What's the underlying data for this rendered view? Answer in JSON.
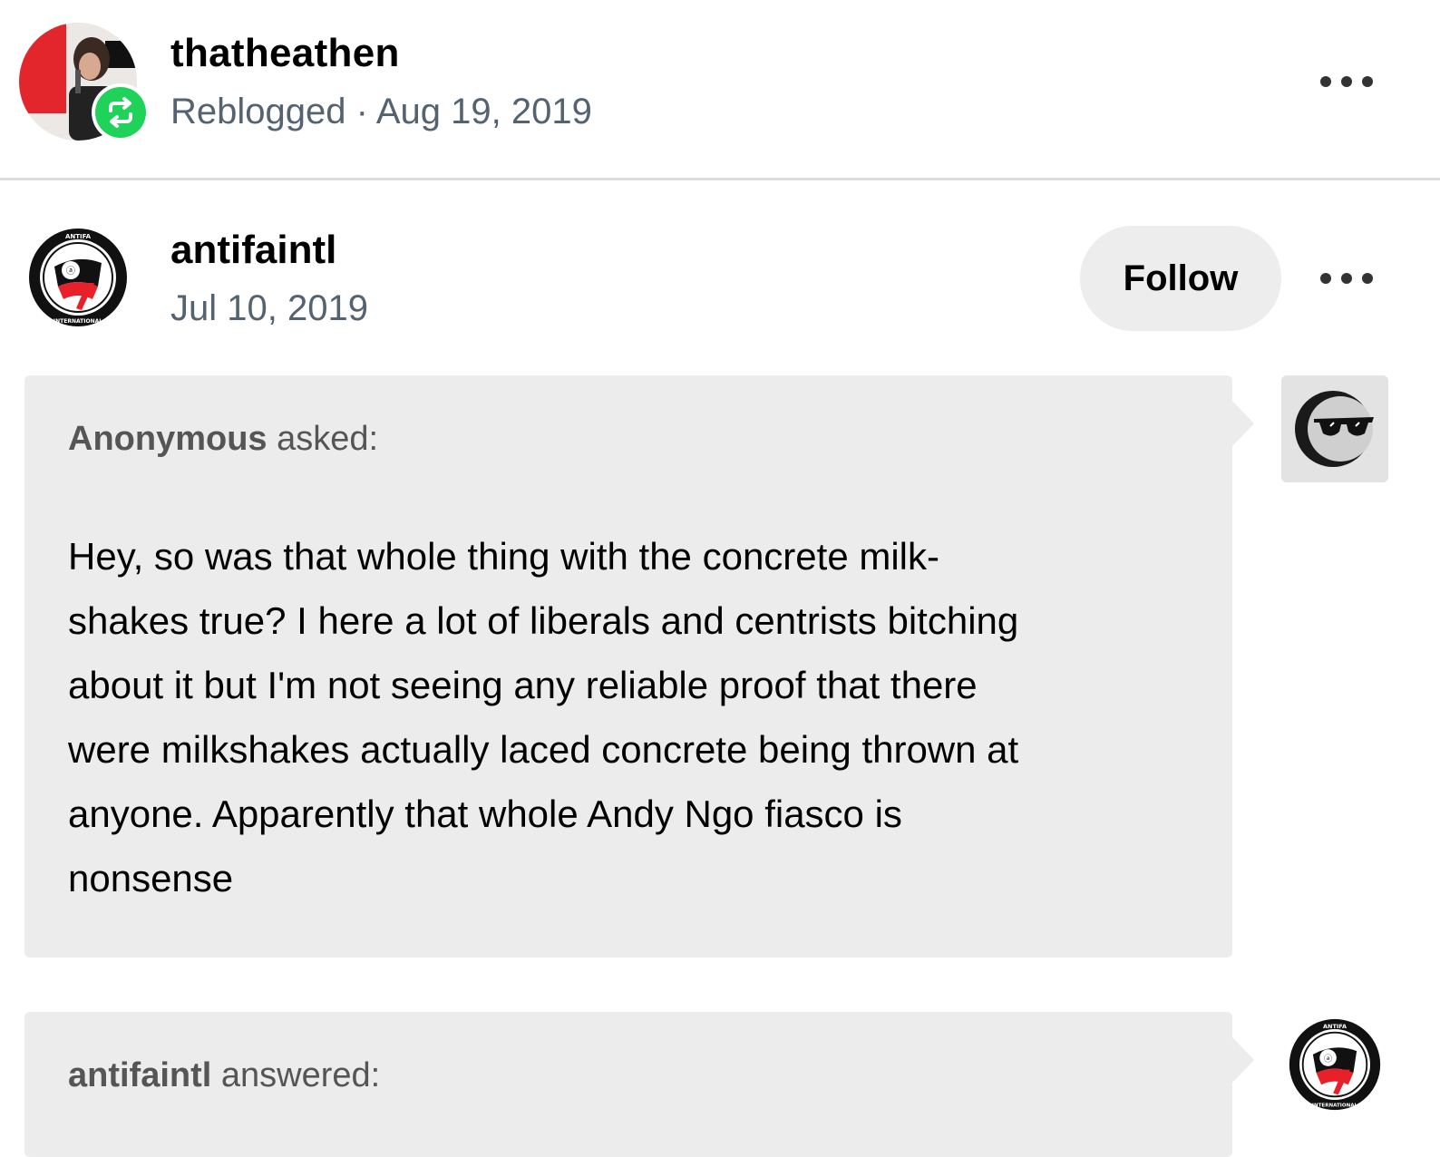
{
  "reblog_header": {
    "username": "thatheathen",
    "status": "Reblogged",
    "separator": "·",
    "date": "Aug 19, 2019",
    "avatar_icon": "reblogger-avatar",
    "badge_icon": "reblog-icon",
    "badge_color": "#1fd35a",
    "menu_icon": "more-options-icon"
  },
  "post": {
    "author": "antifaintl",
    "date": "Jul 10, 2019",
    "follow_label": "Follow",
    "avatar_icon": "antifa-international-logo",
    "logo_text_top": "ANTIFA",
    "logo_text_bottom": "INTERNATIONAL",
    "menu_icon": "more-options-icon"
  },
  "ask": {
    "asker": "Anonymous",
    "asked_suffix": " asked:",
    "question": "Hey, so was that whole thing with the concrete milk-shakes true? I here a lot of liberals and centrists bitching about it but I'm not seeing any reliable proof that there were milkshakes actually laced concrete being thrown at anyone. Apparently that whole Andy Ngo fiasco is nonsense",
    "question_lines": [
      "Hey, so was that whole thing with the concrete milk-",
      "shakes true? I here a lot of liberals and centrists bitching",
      "about it but I'm not seeing any reliable proof that there",
      "were milkshakes actually laced concrete being thrown at",
      "anyone. Apparently that whole Andy Ngo fiasco is",
      "nonsense"
    ],
    "asker_avatar_icon": "anonymous-sunglasses-icon"
  },
  "answer": {
    "answerer": "antifaintl",
    "answered_suffix": " answered:",
    "avatar_icon": "antifa-international-logo"
  },
  "colors": {
    "bubble_bg": "#ececec",
    "meta_text": "#55626f",
    "follow_bg": "#ededed",
    "logo_red": "#e8202a"
  }
}
